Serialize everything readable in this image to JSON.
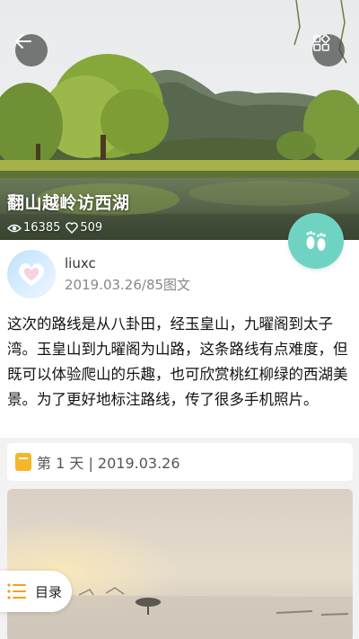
{
  "article": {
    "title": "翻山越岭访西湖",
    "views": "16385",
    "likes": "509"
  },
  "author": {
    "name": "liuxc",
    "meta": "2019.03.26/85图文"
  },
  "body_text": "这次的路线是从八卦田，经玉皇山，九曜阁到太子湾。玉皇山到九曜阁为山路，这条路线有点难度，但既可以体验爬山的乐趣，也可欣赏桃红柳绿的西湖美景。为了更好地标注路线，传了很多手机照片。",
  "day_section": {
    "label": "第 1 天 | 2019.03.26"
  },
  "toc": {
    "label": "目录"
  },
  "icons": {
    "back": "back-arrow-icon",
    "grid": "grid-icon",
    "footprint": "footprint-icon",
    "views": "eye-icon",
    "likes": "heart-icon",
    "toc": "list-icon",
    "day": "notebook-icon"
  },
  "colors": {
    "accent_teal": "#6fd3c3",
    "day_icon": "#f5b62a",
    "toc_icon": "#f0a020"
  }
}
